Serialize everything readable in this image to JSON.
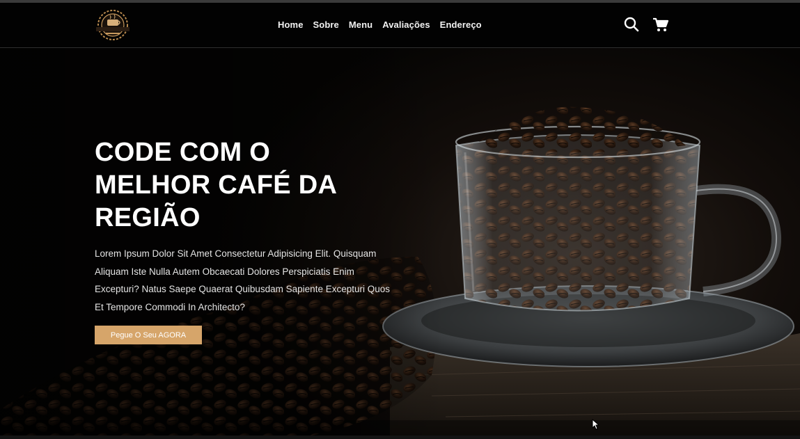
{
  "header": {
    "logo_alt": "CAFEDA",
    "nav": [
      "Home",
      "Sobre",
      "Menu",
      "Avaliações",
      "Endereço"
    ],
    "icons": [
      "search-icon",
      "cart-icon"
    ]
  },
  "hero": {
    "headline": "CODE COM O MELHOR CAFÉ DA REGIÃO",
    "paragraph": "Lorem Ipsum Dolor Sit Amet Consectetur Adipisicing Elit. Quisquam Aliquam Iste Nulla Autem Obcaecati Dolores Perspiciatis Enim Excepturi? Natus Saepe Quaerat Quibusdam Sapiente Excepturi Quos Et Tempore Commodi In Architecto?",
    "cta_label": "Pegue O Seu AGORA"
  },
  "colors": {
    "accent": "#d6a56a",
    "header_bg": "#020202",
    "text": "#ffffff"
  }
}
